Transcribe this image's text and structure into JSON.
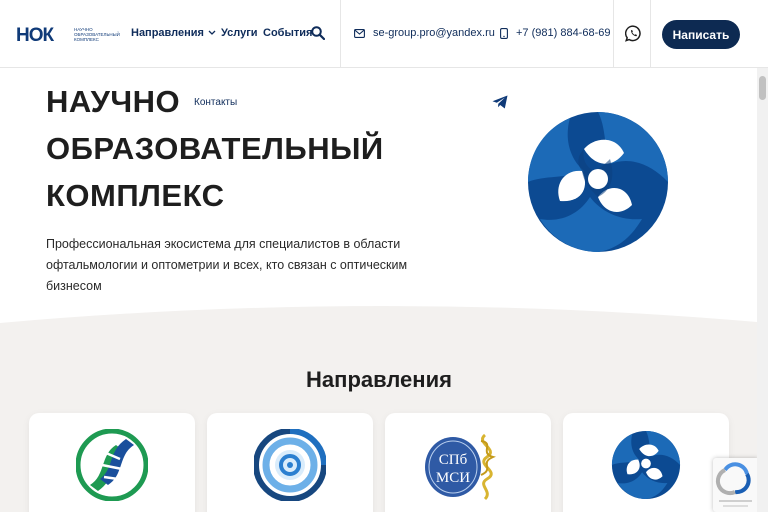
{
  "header": {
    "logo_text": "НОК",
    "logo_subtitle": "научно образовательный комплекс",
    "nav": {
      "directions": "Направления",
      "services": "Услуги",
      "events": "События"
    },
    "email": "se-group.pro@yandex.ru",
    "phone": "+7 (981) 884-68-69",
    "write_button": "Написать"
  },
  "hero": {
    "title": "НАУЧНО ОБРАЗОВАТЕЛЬНЫЙ КОМПЛЕКС",
    "contacts_link": "Контакты",
    "subtitle": "Профессиональная экосистема для специалистов в области офтальмологии и оптометрии и всех, кто связан с оптическим бизнесом"
  },
  "directions_section": {
    "title": "Направления",
    "cards": [
      {
        "icon": "green-blue-helix-logo"
      },
      {
        "icon": "blue-circular-target-logo"
      },
      {
        "icon": "spb-msi-logo",
        "text_top": "СПб",
        "text_bottom": "МСИ"
      },
      {
        "icon": "blue-triskelion-logo"
      }
    ]
  },
  "colors": {
    "brand_dark": "#0d2a52",
    "brand_blue": "#1c67b3",
    "section_bg": "#f3f1ef"
  }
}
